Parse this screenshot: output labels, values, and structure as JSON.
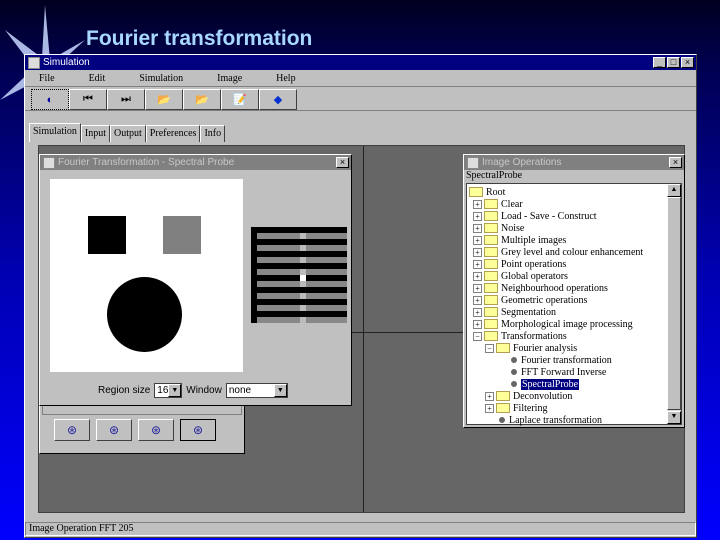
{
  "slide": {
    "title": "Fourier transformation"
  },
  "window": {
    "title": "Simulation",
    "controls": [
      "_",
      "□",
      "×"
    ]
  },
  "menu": [
    "File",
    "Edit",
    "Simulation",
    "Image",
    "Help"
  ],
  "toolbar": [
    {
      "icon": "stop-icon",
      "glyph": "◐"
    },
    {
      "icon": "skip-back-icon",
      "glyph": "⏮"
    },
    {
      "icon": "skip-forward-icon",
      "glyph": "⏭"
    },
    {
      "icon": "open-folder-icon",
      "glyph": "📂"
    },
    {
      "icon": "open-folder-icon",
      "glyph": "📂"
    },
    {
      "icon": "edit-icon",
      "glyph": "📝"
    },
    {
      "icon": "help-icon",
      "glyph": "◆"
    }
  ],
  "tabs": [
    "Simulation",
    "Input",
    "Output",
    "Preferences",
    "Info"
  ],
  "probe": {
    "title": "Fourier Transformation - Spectral Probe",
    "region_label": "Region size",
    "region_value": "16",
    "window_label": "Window",
    "window_value": "none"
  },
  "ops": {
    "title": "Image Operations",
    "selected_label": "SpectralProbe",
    "tree": [
      {
        "label": "Root",
        "level": 0,
        "type": "folder-open"
      },
      {
        "label": "Clear",
        "level": 1,
        "type": "folder"
      },
      {
        "label": "Load - Save - Construct",
        "level": 1,
        "type": "folder"
      },
      {
        "label": "Noise",
        "level": 1,
        "type": "folder"
      },
      {
        "label": "Multiple images",
        "level": 1,
        "type": "folder"
      },
      {
        "label": "Grey level and colour enhancement",
        "level": 1,
        "type": "folder"
      },
      {
        "label": "Point operations",
        "level": 1,
        "type": "folder"
      },
      {
        "label": "Global operators",
        "level": 1,
        "type": "folder"
      },
      {
        "label": "Neighbourhood operations",
        "level": 1,
        "type": "folder"
      },
      {
        "label": "Geometric operations",
        "level": 1,
        "type": "folder"
      },
      {
        "label": "Segmentation",
        "level": 1,
        "type": "folder"
      },
      {
        "label": "Morphological image processing",
        "level": 1,
        "type": "folder"
      },
      {
        "label": "Transformations",
        "level": 1,
        "type": "folder-open"
      },
      {
        "label": "Fourier analysis",
        "level": 2,
        "type": "folder-open"
      },
      {
        "label": "Fourier transformation",
        "level": 3,
        "type": "leaf"
      },
      {
        "label": "FFT Forward Inverse",
        "level": 3,
        "type": "leaf"
      },
      {
        "label": "SpectralProbe",
        "level": 3,
        "type": "leaf",
        "selected": true
      },
      {
        "label": "Deconvolution",
        "level": 2,
        "type": "folder"
      },
      {
        "label": "Filtering",
        "level": 2,
        "type": "folder"
      },
      {
        "label": "Laplace transformation",
        "level": 2,
        "type": "leaf"
      }
    ]
  },
  "status": "Image Operation   FFT 205"
}
